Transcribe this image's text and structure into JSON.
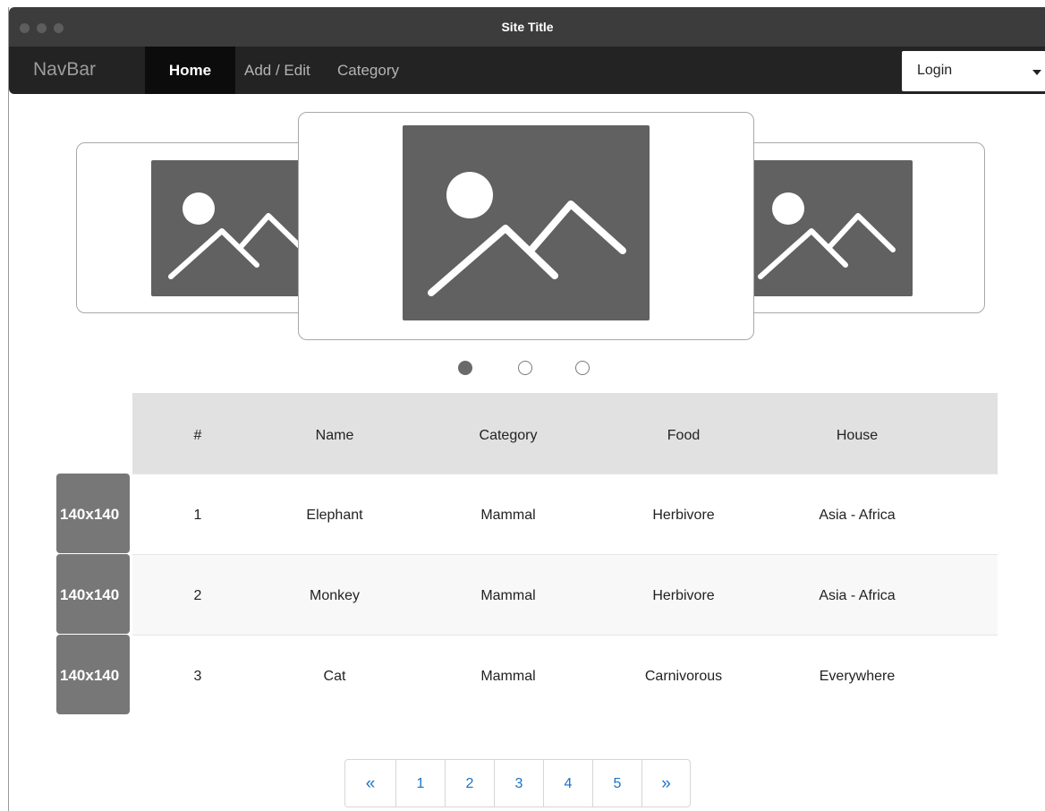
{
  "window": {
    "title": "Site Title"
  },
  "navbar": {
    "brand": "NavBar",
    "items": [
      {
        "label": "Home",
        "active": true
      },
      {
        "label": "Add / Edit",
        "active": false
      },
      {
        "label": "Category",
        "active": false
      }
    ],
    "login": {
      "label": "Login",
      "icon": "caret-down-icon"
    }
  },
  "carousel": {
    "slides": [
      "image-placeholder-icon",
      "image-placeholder-icon",
      "image-placeholder-icon"
    ],
    "active_index": 0,
    "indicator_count": 3
  },
  "table": {
    "headers": [
      "#",
      "Name",
      "Category",
      "Food",
      "House"
    ],
    "rows": [
      {
        "thumb": "140x140",
        "cells": [
          "1",
          "Elephant",
          "Mammal",
          "Herbivore",
          "Asia - Africa"
        ]
      },
      {
        "thumb": "140x140",
        "cells": [
          "2",
          "Monkey",
          "Mammal",
          "Herbivore",
          "Asia - Africa"
        ]
      },
      {
        "thumb": "140x140",
        "cells": [
          "3",
          "Cat",
          "Mammal",
          "Carnivorous",
          "Everywhere"
        ]
      }
    ]
  },
  "pagination": {
    "prev": "«",
    "pages": [
      "1",
      "2",
      "3",
      "4",
      "5"
    ],
    "next": "»"
  },
  "colors": {
    "navbar": "#232323",
    "titlebar": "#3c3c3c",
    "link": "#1a73c9",
    "placeholder": "#616161"
  }
}
